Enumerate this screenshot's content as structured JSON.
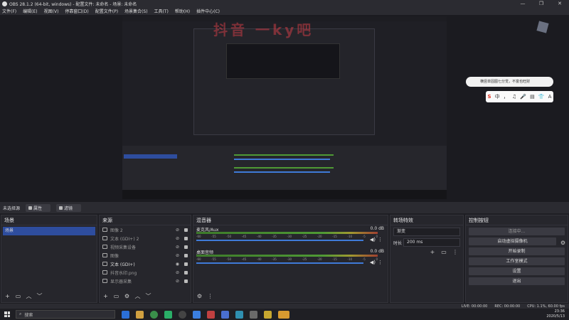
{
  "window": {
    "title": "OBS 28.1.2 (64-bit, windows) - 配置文件: 未命名 - 场景: 未命名",
    "controls": [
      "—",
      "❐",
      "✕"
    ]
  },
  "menu": [
    "文件(F)",
    "编辑(E)",
    "视图(V)",
    "停靠窗口(D)",
    "配置文件(P)",
    "场景集合(S)",
    "工具(T)",
    "帮助(H)",
    "插件中心(C)"
  ],
  "watermark": "抖音 一ky吧",
  "ime": {
    "bubble": "横竖单固图七分觉，不富也旺财",
    "keys": [
      "S",
      "中",
      "，",
      "♫",
      "🎤",
      "▤",
      "👕",
      "A"
    ]
  },
  "status_strip": {
    "no_source": "未选择源",
    "properties": "属性",
    "filters": "滤镜"
  },
  "scenes": {
    "title": "场景",
    "items": [
      "场景"
    ]
  },
  "sources": {
    "title": "来源",
    "items": [
      "图像 2",
      "文本 (GDI+) 2",
      "视频采集设备",
      "图像",
      "文本 (GDI+)",
      "抖音水印.png",
      "显示器采集"
    ]
  },
  "mixer": {
    "title": "混音器",
    "channels": [
      {
        "name": "麦克风/Aux",
        "db": "0.0 dB"
      },
      {
        "name": "桌面音频",
        "db": "0.0 dB"
      }
    ],
    "ticks": [
      "-60",
      "-55",
      "-50",
      "-45",
      "-40",
      "-35",
      "-30",
      "-25",
      "-20",
      "-15",
      "-10",
      "-5",
      "0"
    ]
  },
  "transitions": {
    "title": "转场特效",
    "selected": "渐变",
    "duration_label": "时长",
    "duration": "200 ms"
  },
  "controls": {
    "title": "控制按钮",
    "buttons": [
      "连接中...",
      "启动虚拟摄像机",
      "开始录制",
      "工作室模式",
      "设置",
      "退出"
    ]
  },
  "statusbar": {
    "live": "LIVE: 00:00:00",
    "rec": "REC: 00:00:00",
    "cpu": "CPU: 1.1%, 60.00 fps"
  },
  "taskbar": {
    "search": "搜索",
    "time": "23:36",
    "date": "2020/5/13"
  },
  "colors": {
    "accent": "#2e4d9e",
    "background": "#1e1e23",
    "panel": "#26262c"
  }
}
